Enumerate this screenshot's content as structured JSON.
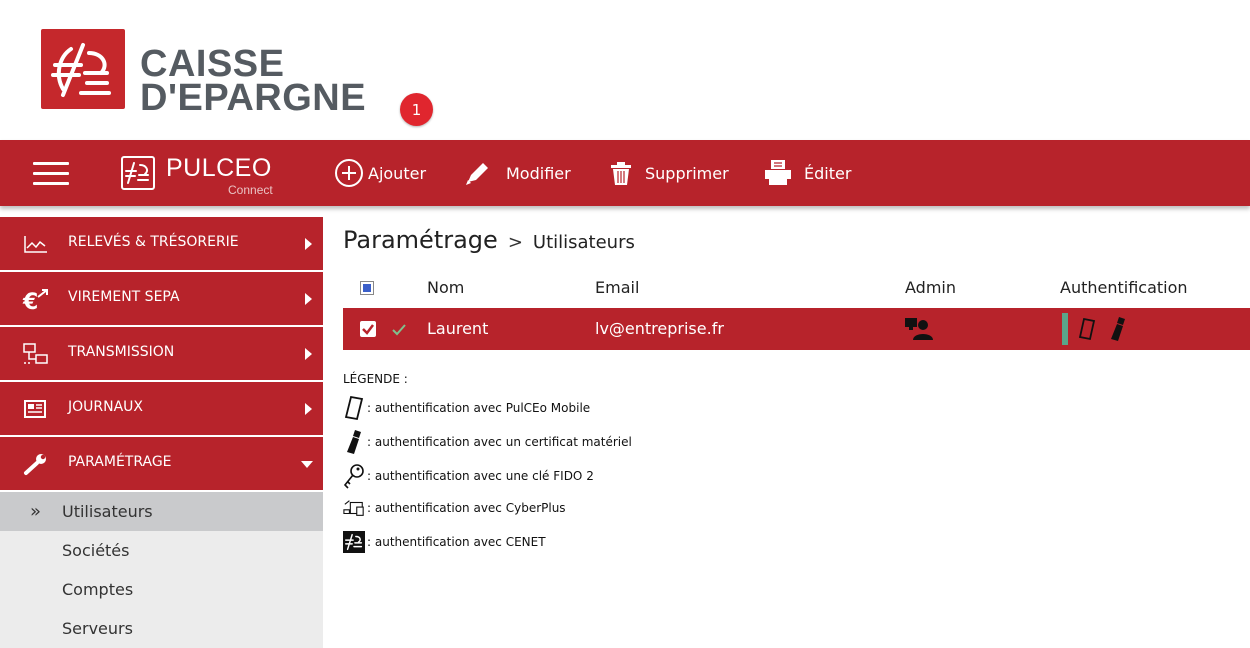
{
  "brand": {
    "line1": "CAISSE",
    "line2": "D'EPARGNE",
    "notification_count": "1",
    "app_name": "PULCEO",
    "app_subtitle": "Connect"
  },
  "toolbar": {
    "add_label": "Ajouter",
    "edit_label": "Modifier",
    "delete_label": "Supprimer",
    "print_label": "Éditer"
  },
  "sidebar": {
    "items": [
      {
        "label": "RELEVÉS & TRÉSORERIE",
        "icon": "chart-line-icon"
      },
      {
        "label": "VIREMENT SEPA",
        "icon": "euro-transfer-icon"
      },
      {
        "label": "TRANSMISSION",
        "icon": "network-icon"
      },
      {
        "label": "JOURNAUX",
        "icon": "newspaper-icon"
      },
      {
        "label": "PARAMÉTRAGE",
        "icon": "wrench-icon"
      }
    ],
    "subitems": [
      {
        "label": "Utilisateurs",
        "active": true
      },
      {
        "label": "Sociétés"
      },
      {
        "label": "Comptes"
      },
      {
        "label": "Serveurs"
      }
    ]
  },
  "breadcrumb": {
    "root": "Paramétrage",
    "separator": ">",
    "leaf": "Utilisateurs"
  },
  "table": {
    "columns": [
      "Nom",
      "Email",
      "Admin",
      "Authentification"
    ],
    "rows": [
      {
        "name": "Laurent",
        "email": "lv@entreprise.fr",
        "admin": true,
        "selected": true,
        "auth": [
          "mobile",
          "usb-key"
        ]
      }
    ]
  },
  "legend": {
    "title": "LÉGENDE :",
    "items": [
      {
        "icon": "mobile-phone-icon",
        "text": ": authentification avec PulCEo Mobile"
      },
      {
        "icon": "usb-key-icon",
        "text": ": authentification avec un certificat matériel"
      },
      {
        "icon": "key-icon",
        "text": ": authentification avec une clé FIDO 2"
      },
      {
        "icon": "devices-icon",
        "text": ": authentification avec CyberPlus"
      },
      {
        "icon": "cenet-logo-icon",
        "text": ": authentification avec CENET"
      }
    ]
  },
  "colors": {
    "primary": "#b7232b",
    "badge": "#e0262e",
    "logo_text": "#555b61",
    "sidebar_sub_bg": "#ececec",
    "sidebar_active": "#c9cacc",
    "auth_bar": "#5aa68a",
    "header_checkbox": "#3b5fc9"
  }
}
